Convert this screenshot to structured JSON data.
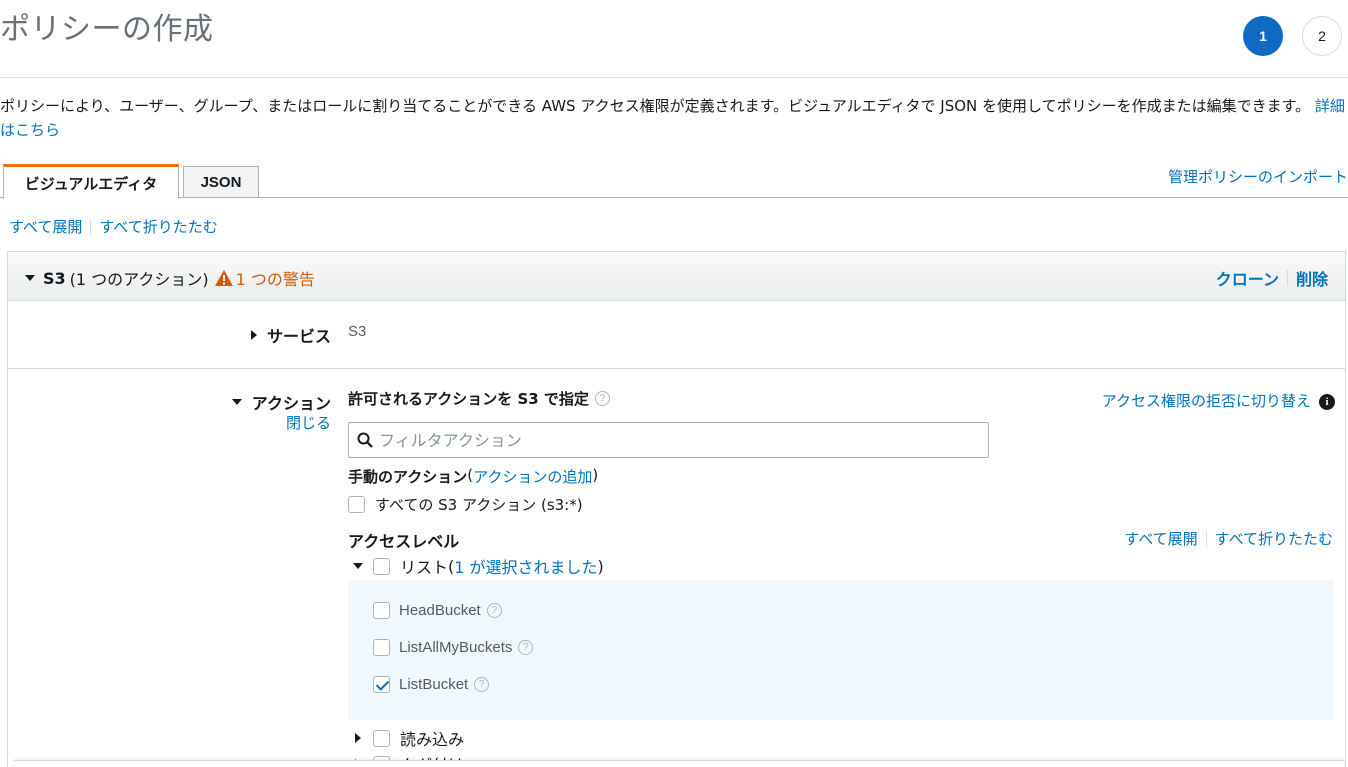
{
  "page": {
    "title": "ポリシーの作成",
    "steps": [
      "1",
      "2"
    ],
    "description": "ポリシーにより、ユーザー、グループ、またはロールに割り当てることができる AWS アクセス権限が定義されます。ビジュアルエディタで JSON を使用してポリシーを作成または編集できます。",
    "details_link": "詳細はこちら"
  },
  "tabs": {
    "visual": "ビジュアルエディタ",
    "json": "JSON",
    "import_link": "管理ポリシーのインポート"
  },
  "toolbar": {
    "expand_all": "すべて展開",
    "collapse_all": "すべて折りたたむ"
  },
  "panel": {
    "service_name": "S3",
    "action_count": "(1 つのアクション)",
    "warning": "1 つの警告",
    "clone": "クローン",
    "delete": "削除",
    "service_label": "サービス",
    "service_value": "S3",
    "actions_label": "アクション",
    "close_link": "閉じる",
    "allowed_title": "許可されるアクションを S3 で指定",
    "deny_link": "アクセス権限の拒否に切り替え",
    "info": "i",
    "filter_placeholder": "フィルタアクション",
    "manual_title": "手動のアクション",
    "manual_paren_open": "(",
    "add_action": "アクションの追加",
    "manual_paren_close": ")",
    "all_s3_label": "すべての S3 アクション (s3:*)",
    "access_level_title": "アクセスレベル",
    "access_expand_all": "すべて展開",
    "access_collapse_all": "すべて折りたたむ",
    "list_label": "リスト",
    "list_selected_open": "(",
    "list_selected": "1 が選択されました",
    "list_selected_close": ")",
    "list_items": [
      {
        "label": "HeadBucket",
        "checked": false
      },
      {
        "label": "ListAllMyBuckets",
        "checked": false
      },
      {
        "label": "ListBucket",
        "checked": true
      }
    ],
    "read_label": "読み込み",
    "tag_label": "タグ付け"
  }
}
